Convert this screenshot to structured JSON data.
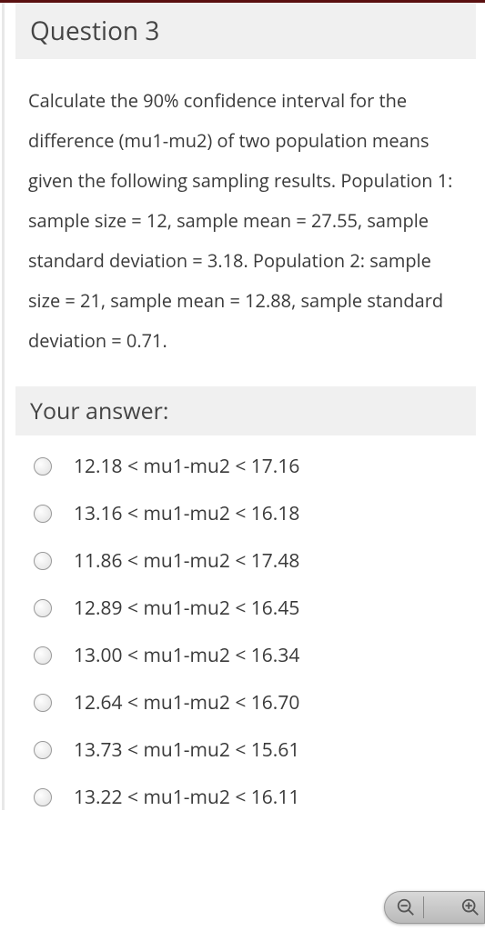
{
  "question": {
    "title": "Question 3",
    "text": "Calculate the 90% confidence interval for the difference (mu1-mu2) of two population means given the following sampling results. Population 1: sample size = 12, sample mean = 27.55, sample standard deviation = 3.18. Population 2: sample size = 21, sample mean = 12.88, sample standard deviation = 0.71."
  },
  "answer_header": "Your answer:",
  "options": [
    {
      "label": "12.18 < mu1-mu2 < 17.16"
    },
    {
      "label": "13.16 < mu1-mu2 < 16.18"
    },
    {
      "label": "11.86 < mu1-mu2 < 17.48"
    },
    {
      "label": "12.89 < mu1-mu2 < 16.45"
    },
    {
      "label": "13.00 < mu1-mu2 < 16.34"
    },
    {
      "label": "12.64 < mu1-mu2 < 16.70"
    },
    {
      "label": "13.73 < mu1-mu2 < 15.61"
    },
    {
      "label": "13.22 < mu1-mu2 < 16.11"
    }
  ]
}
